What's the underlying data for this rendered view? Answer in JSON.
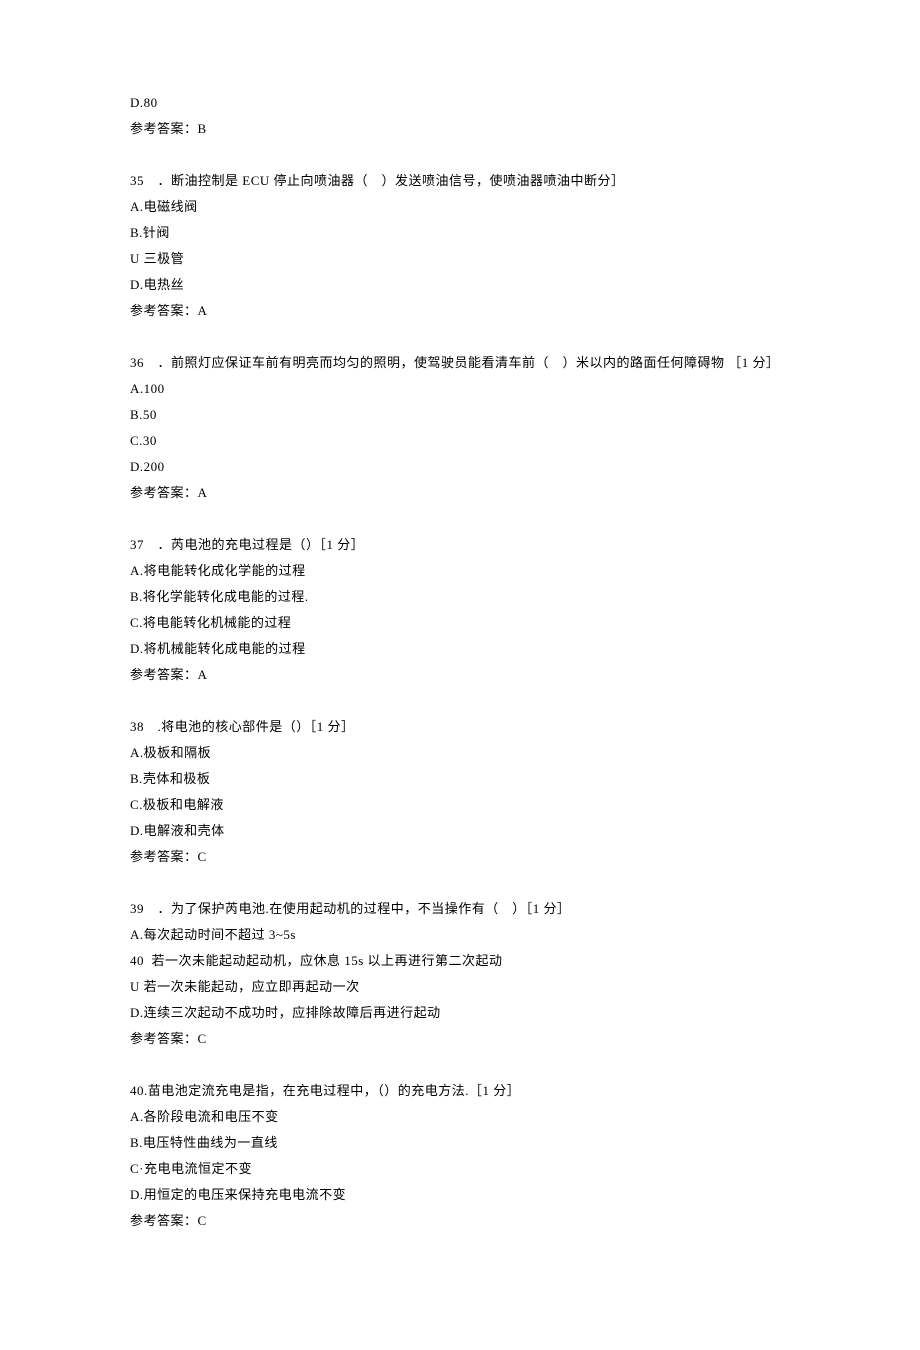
{
  "prelude": {
    "lines": [
      "D.80",
      "参考答案：B"
    ]
  },
  "questions": [
    {
      "num": "35",
      "stem": "．断油控制是 ECU 停止向喷油器（　）发送喷油信号，使喷油器喷油中断分］",
      "options": [
        "A.电磁线阀",
        "B.针阀",
        "U 三极管",
        "D.电热丝"
      ],
      "answer": "参考答案：A"
    },
    {
      "num": "36",
      "stem": "．前照灯应保证车前有明亮而均匀的照明，使驾驶员能看清车前（　）米以内的路面任何障碍物 ［1 分］",
      "options": [
        "A.100",
        "B.50",
        "C.30",
        "D.200"
      ],
      "answer": "参考答案：A"
    },
    {
      "num": "37",
      "stem": "．芮电池的充电过程是（）［1 分］",
      "options": [
        "A.将电能转化成化学能的过程",
        "B.将化学能转化成电能的过程.",
        "C.将电能转化机械能的过程",
        "D.将机械能转化成电能的过程"
      ],
      "answer": "参考答案：A"
    },
    {
      "num": "38",
      "stem": ".将电池的核心部件是（）［1 分］",
      "options": [
        "A.极板和隔板",
        "B.壳体和极板",
        "C.极板和电解液",
        "D.电解液和壳体"
      ],
      "answer": "参考答案：C"
    },
    {
      "num": "39",
      "stem": "．为了保护芮电池.在使用起动机的过程中，不当操作有（　）［1 分］",
      "options": [
        "A.每次起动时间不超过 3~5s",
        "40  若一次未能起动起动机，应休息 15s 以上再进行第二次起动",
        "U 若一次未能起动，应立即再起动一次",
        "D.连续三次起动不成功时，应排除故障后再进行起动"
      ],
      "answer": "参考答案：C"
    },
    {
      "num": "40",
      "stem": "40.苗电池定流充电是指，在充电过程中，（）的充电方法.［1 分］",
      "options": [
        "A.各阶段电流和电压不变",
        "B.电压特性曲线为一直线",
        "C·充电电流恒定不变",
        "D.用恒定的电压来保持充电电流不变"
      ],
      "answer": "参考答案：C",
      "stem_full": true
    }
  ]
}
